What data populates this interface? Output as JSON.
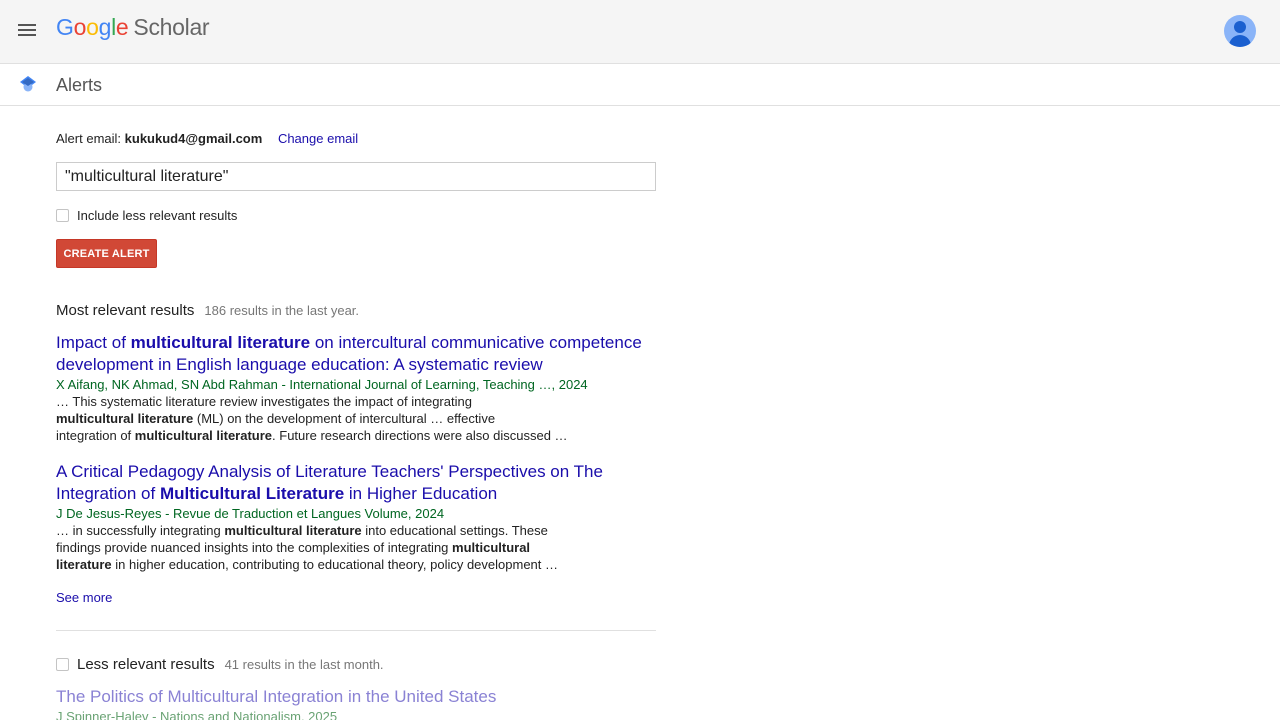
{
  "brand": {
    "letters": [
      "G",
      "o",
      "o",
      "g",
      "l",
      "e"
    ],
    "scholar": "Scholar",
    "colors": {
      "blue": "#4285f4",
      "red": "#ea4335",
      "yellow": "#fbbc05",
      "green": "#34a853"
    }
  },
  "header": {
    "menu_icon": "hamburger-menu-icon",
    "avatar_icon": "account-avatar-icon"
  },
  "subbar": {
    "title": "Alerts",
    "icon": "scholar-cap-icon"
  },
  "alert_form": {
    "email_label": "Alert email:",
    "email": "kukukud4@gmail.com",
    "change_email": "Change email",
    "query_value": "\"multicultural literature\"",
    "checkbox_label": "Include less relevant results",
    "create_button": "CREATE ALERT",
    "button_color": "#d14836"
  },
  "most_relevant": {
    "title": "Most relevant results",
    "count": "186 results in the last year.",
    "see_more": "See more",
    "results": [
      {
        "title_parts": [
          "Impact of ",
          "multicultural literature",
          " on intercultural communicative competence development in English language education: A systematic review"
        ],
        "meta": "X Aifang, NK Ahmad, SN Abd Rahman - International Journal of Learning, Teaching …, 2024",
        "snippet": {
          "l1": "… This systematic literature review investigates the impact of integrating",
          "l2b": "multicultural literature",
          "l2": " (ML) on the development of intercultural … effective",
          "l3a": "integration of ",
          "l3b": "multicultural literature",
          "l3c": ". Future research directions were also discussed …"
        }
      },
      {
        "title_parts": [
          "A Critical Pedagogy Analysis of Literature Teachers' Perspectives on The Integration of ",
          "Multicultural Literature",
          " in Higher Education"
        ],
        "meta": "J De Jesus-Reyes - Revue de Traduction et Langues Volume, 2024",
        "snippet": {
          "l1a": "… in successfully integrating ",
          "l1b": "multicultural literature",
          "l1c": " into educational settings. These",
          "l2a": "findings provide nuanced insights into the complexities of integrating ",
          "l2b": "multicultural",
          "l3b": "literature",
          "l3c": " in higher education, contributing to educational theory, policy development …"
        }
      }
    ]
  },
  "less_relevant": {
    "title": "Less relevant results",
    "count": "41 results in the last month.",
    "results": [
      {
        "title": "The Politics of Multicultural Integration in the United States",
        "meta": "J Spinner-Halev - Nations and Nationalism, 2025"
      }
    ]
  }
}
